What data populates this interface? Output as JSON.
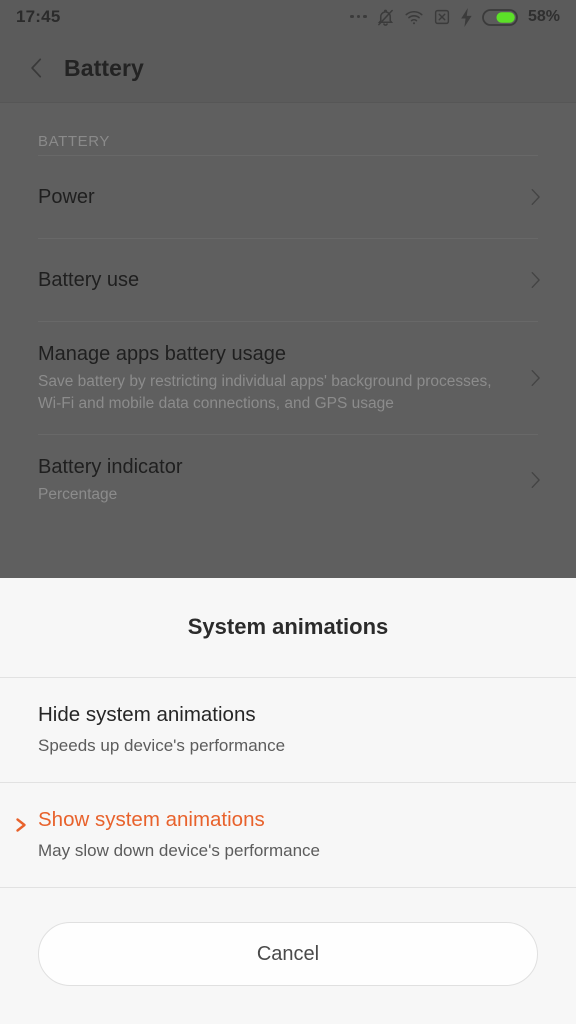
{
  "status_bar": {
    "clock": "17:45",
    "battery_percent": "58%",
    "battery_level": 58,
    "icons": [
      "more-dots-icon",
      "bell-muted-icon",
      "wifi-icon",
      "sim-missing-icon",
      "charging-bolt-icon",
      "battery-icon"
    ]
  },
  "app_bar": {
    "back_label": "back-chevron",
    "title": "Battery"
  },
  "settings": {
    "section_header": "BATTERY",
    "rows": [
      {
        "title": "Power",
        "subtitle": ""
      },
      {
        "title": "Battery use",
        "subtitle": ""
      },
      {
        "title": "Manage apps battery usage",
        "subtitle": "Save battery by restricting individual apps' background processes, Wi-Fi and mobile data connections, and GPS usage"
      },
      {
        "title": "Battery indicator",
        "subtitle": "Percentage"
      }
    ]
  },
  "sheet": {
    "title": "System animations",
    "options": [
      {
        "title": "Hide system animations",
        "subtitle": "Speeds up device's performance",
        "selected": false
      },
      {
        "title": "Show system animations",
        "subtitle": "May slow down device's performance",
        "selected": true
      }
    ],
    "cancel_label": "Cancel",
    "accent_color": "#e8622c"
  }
}
